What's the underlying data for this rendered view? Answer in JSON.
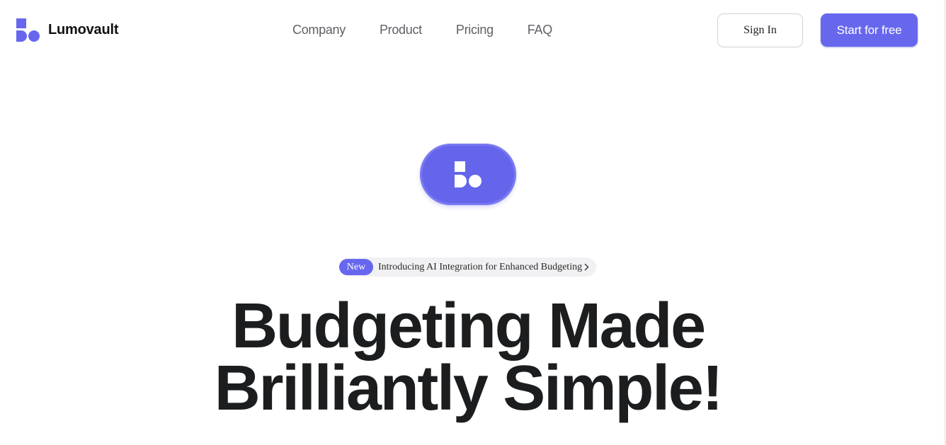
{
  "brand": {
    "name": "Lumovault",
    "icon": "lumovault-logo-icon",
    "accent": "#6767ee"
  },
  "nav": {
    "items": [
      "Company",
      "Product",
      "Pricing",
      "FAQ"
    ]
  },
  "header": {
    "sign_in_label": "Sign In",
    "start_label": "Start for free"
  },
  "announcement": {
    "badge": "New",
    "text": "Introducing AI Integration for Enhanced Budgeting",
    "icon": "chevron-right-icon"
  },
  "hero": {
    "badge_icon": "lumovault-logo-icon",
    "headline_line1": "Budgeting Made",
    "headline_line2": "Brilliantly Simple!"
  }
}
